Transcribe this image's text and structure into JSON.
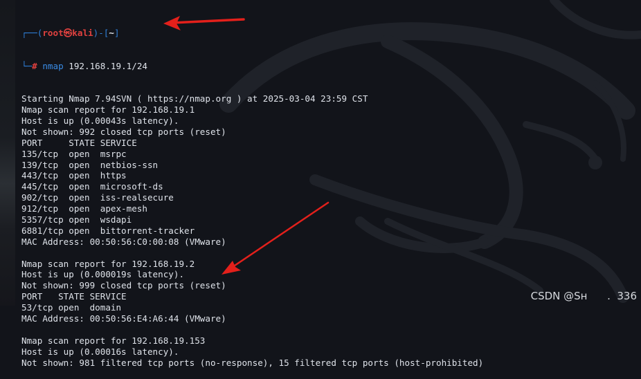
{
  "prompt": {
    "open": "┌──(",
    "user": "root",
    "at": "㉿",
    "host": "kali",
    "mid": ")-[",
    "dir": "~",
    "close": "]",
    "lower": "└─",
    "hash": "# ",
    "command": "nmap",
    "args": " 192.168.19.1/24"
  },
  "output_lines": [
    "Starting Nmap 7.94SVN ( https://nmap.org ) at 2025-03-04 23:59 CST",
    "Nmap scan report for 192.168.19.1",
    "Host is up (0.00043s latency).",
    "Not shown: 992 closed tcp ports (reset)",
    "PORT     STATE SERVICE",
    "135/tcp  open  msrpc",
    "139/tcp  open  netbios-ssn",
    "443/tcp  open  https",
    "445/tcp  open  microsoft-ds",
    "902/tcp  open  iss-realsecure",
    "912/tcp  open  apex-mesh",
    "5357/tcp open  wsdapi",
    "6881/tcp open  bittorrent-tracker",
    "MAC Address: 00:50:56:C0:00:08 (VMware)",
    "",
    "Nmap scan report for 192.168.19.2",
    "Host is up (0.000019s latency).",
    "Not shown: 999 closed tcp ports (reset)",
    "PORT   STATE SERVICE",
    "53/tcp open  domain",
    "MAC Address: 00:50:56:E4:A6:44 (VMware)",
    "",
    "Nmap scan report for 192.168.19.153",
    "Host is up (0.00016s latency).",
    "Not shown: 981 filtered tcp ports (no-response), 15 filtered tcp ports (host-prohibited)"
  ],
  "watermark": "CSDN @Sн      .  336",
  "colors": {
    "background": "#12141a",
    "text": "#dfe3ea",
    "prompt_blue": "#2f7fd8",
    "prompt_red": "#e0413f",
    "arrow_red": "#e3201b"
  },
  "icons": [
    "kali-dragon-logo",
    "annotation-arrow"
  ]
}
